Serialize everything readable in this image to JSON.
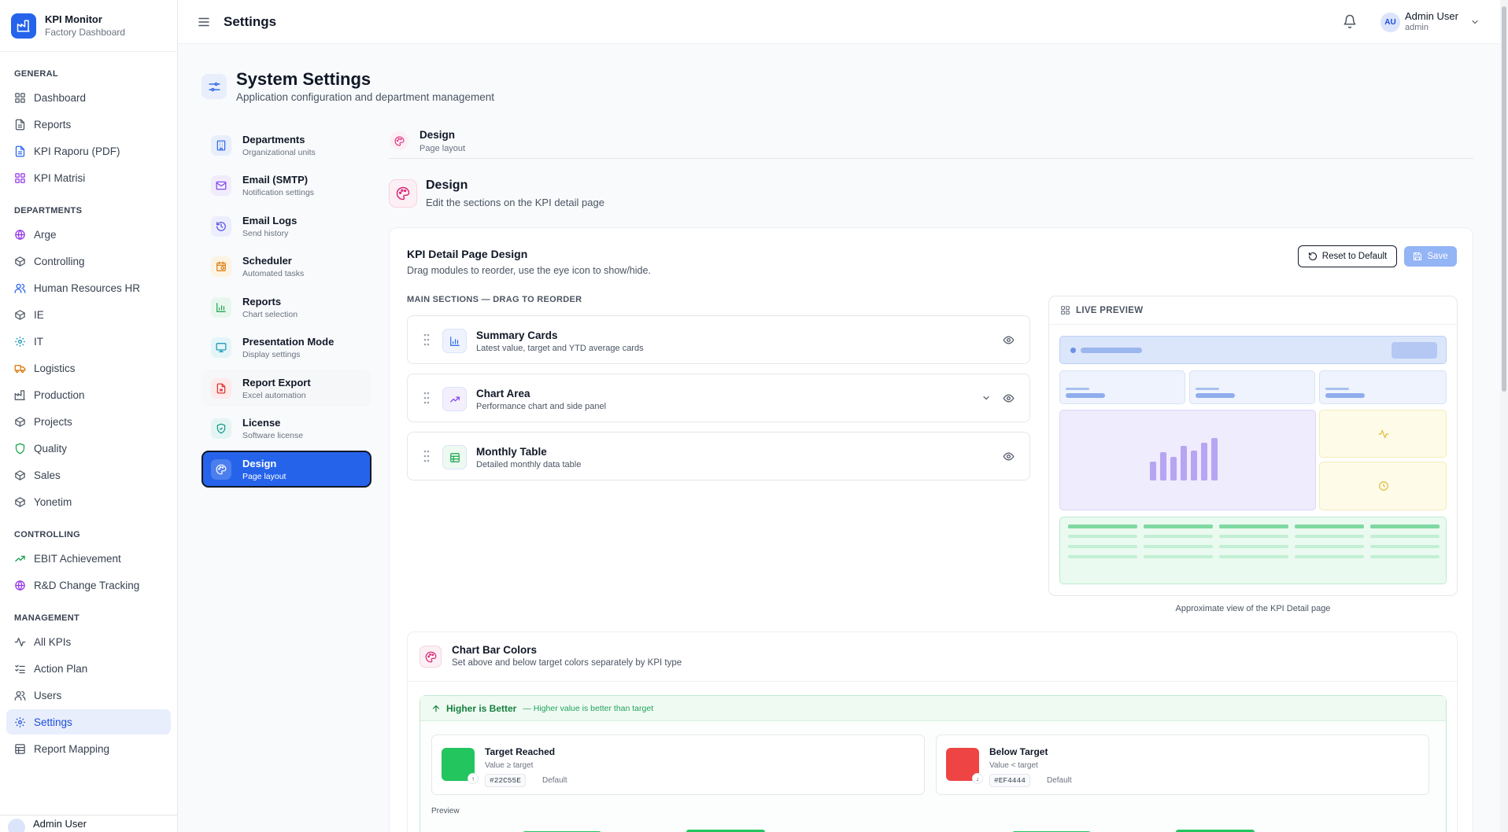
{
  "app": {
    "name": "KPI Monitor",
    "subtitle": "Factory Dashboard"
  },
  "header": {
    "title": "Settings",
    "user_initials": "AU",
    "user_name": "Admin User",
    "user_role": "admin"
  },
  "sidebar": {
    "sections": [
      {
        "label": "GENERAL",
        "items": [
          {
            "label": "Dashboard",
            "icon": "grid-icon",
            "active": false
          },
          {
            "label": "Reports",
            "icon": "file-text-icon",
            "active": false
          },
          {
            "label": "KPI Raporu (PDF)",
            "icon": "file-text-icon",
            "active": false
          },
          {
            "label": "KPI Matrisi",
            "icon": "grid-icon",
            "active": false
          }
        ]
      },
      {
        "label": "DEPARTMENTS",
        "items": [
          {
            "label": "Arge",
            "icon": "globe-icon",
            "active": false
          },
          {
            "label": "Controlling",
            "icon": "box-icon",
            "active": false
          },
          {
            "label": "Human Resources HR",
            "icon": "users-icon",
            "active": false
          },
          {
            "label": "IE",
            "icon": "box-icon",
            "active": false
          },
          {
            "label": "IT",
            "icon": "gear-icon",
            "active": false
          },
          {
            "label": "Logistics",
            "icon": "truck-icon",
            "active": false
          },
          {
            "label": "Production",
            "icon": "factory-icon",
            "active": false
          },
          {
            "label": "Projects",
            "icon": "box-icon",
            "active": false
          },
          {
            "label": "Quality",
            "icon": "shield-icon",
            "active": false
          },
          {
            "label": "Sales",
            "icon": "box-icon",
            "active": false
          },
          {
            "label": "Yonetim",
            "icon": "box-icon",
            "active": false
          }
        ]
      },
      {
        "label": "CONTROLLING",
        "items": [
          {
            "label": "EBIT Achievement",
            "icon": "trending-up-icon",
            "active": false
          },
          {
            "label": "R&D Change Tracking",
            "icon": "globe-icon",
            "active": false
          }
        ]
      },
      {
        "label": "MANAGEMENT",
        "items": [
          {
            "label": "All KPIs",
            "icon": "activity-icon",
            "active": false
          },
          {
            "label": "Action Plan",
            "icon": "list-checks-icon",
            "active": false
          },
          {
            "label": "Users",
            "icon": "users-icon",
            "active": false
          },
          {
            "label": "Settings",
            "icon": "gear-icon",
            "active": true
          },
          {
            "label": "Report Mapping",
            "icon": "table-icon",
            "active": false
          }
        ]
      }
    ],
    "footer_user": "Admin User"
  },
  "page": {
    "title": "System Settings",
    "subtitle": "Application configuration and department management"
  },
  "settings_menu": [
    {
      "title": "Departments",
      "sub": "Organizational units",
      "icon": "building-icon",
      "color": "#2563eb",
      "bg": "#e8eefc",
      "state": ""
    },
    {
      "title": "Email (SMTP)",
      "sub": "Notification settings",
      "icon": "mail-icon",
      "color": "#7c3aed",
      "bg": "#f1ecfd",
      "state": ""
    },
    {
      "title": "Email Logs",
      "sub": "Send history",
      "icon": "history-icon",
      "color": "#4f46e5",
      "bg": "#eceefd",
      "state": ""
    },
    {
      "title": "Scheduler",
      "sub": "Automated tasks",
      "icon": "calendar-clock-icon",
      "color": "#d97706",
      "bg": "#fdf3e3",
      "state": ""
    },
    {
      "title": "Reports",
      "sub": "Chart selection",
      "icon": "bar-chart-icon",
      "color": "#16a34a",
      "bg": "#e8f7ee",
      "state": ""
    },
    {
      "title": "Presentation Mode",
      "sub": "Display settings",
      "icon": "monitor-icon",
      "color": "#0891b2",
      "bg": "#e4f5f8",
      "state": ""
    },
    {
      "title": "Report Export",
      "sub": "Excel automation",
      "icon": "file-export-icon",
      "color": "#dc2626",
      "bg": "#fdeaea",
      "state": "hl"
    },
    {
      "title": "License",
      "sub": "Software license",
      "icon": "shield-check-icon",
      "color": "#0d9488",
      "bg": "#e3f5f3",
      "state": ""
    },
    {
      "title": "Design",
      "sub": "Page layout",
      "icon": "palette-icon",
      "color": "#ffffff",
      "bg": "",
      "state": "active"
    }
  ],
  "crumb": {
    "title": "Design",
    "sub": "Page layout"
  },
  "section": {
    "title": "Design",
    "sub": "Edit the sections on the KPI detail page"
  },
  "card": {
    "title": "KPI Detail Page Design",
    "sub": "Drag modules to reorder, use the eye icon to show/hide.",
    "reset_label": "Reset to Default",
    "save_label": "Save",
    "main_sections_label": "MAIN SECTIONS — DRAG TO REORDER",
    "modules": [
      {
        "title": "Summary Cards",
        "sub": "Latest value, target and YTD average cards",
        "icon": "bar-chart-icon",
        "color": "#2563eb",
        "bg": "#eef3fd",
        "expandable": false
      },
      {
        "title": "Chart Area",
        "sub": "Performance chart and side panel",
        "icon": "trending-up-icon",
        "color": "#7c3aed",
        "bg": "#f3effd",
        "expandable": true
      },
      {
        "title": "Monthly Table",
        "sub": "Detailed monthly data table",
        "icon": "table-icon",
        "color": "#16a34a",
        "bg": "#edf9f1",
        "expandable": false
      }
    ],
    "preview_label": "LIVE PREVIEW",
    "preview_caption": "Approximate view of the KPI Detail page"
  },
  "bar_colors": {
    "title": "Chart Bar Colors",
    "sub": "Set above and below target colors separately by KPI type",
    "higher_title": "Higher is Better",
    "higher_note": "— Higher value is better than target",
    "target_reached": {
      "title": "Target Reached",
      "sub": "Value ≥ target",
      "hex": "#22C55E",
      "default_label": "Default",
      "color": "#22c55e"
    },
    "below_target": {
      "title": "Below Target",
      "sub": "Value < target",
      "hex": "#EF4444",
      "default_label": "Default",
      "color": "#ef4444"
    },
    "preview_label": "Preview"
  }
}
